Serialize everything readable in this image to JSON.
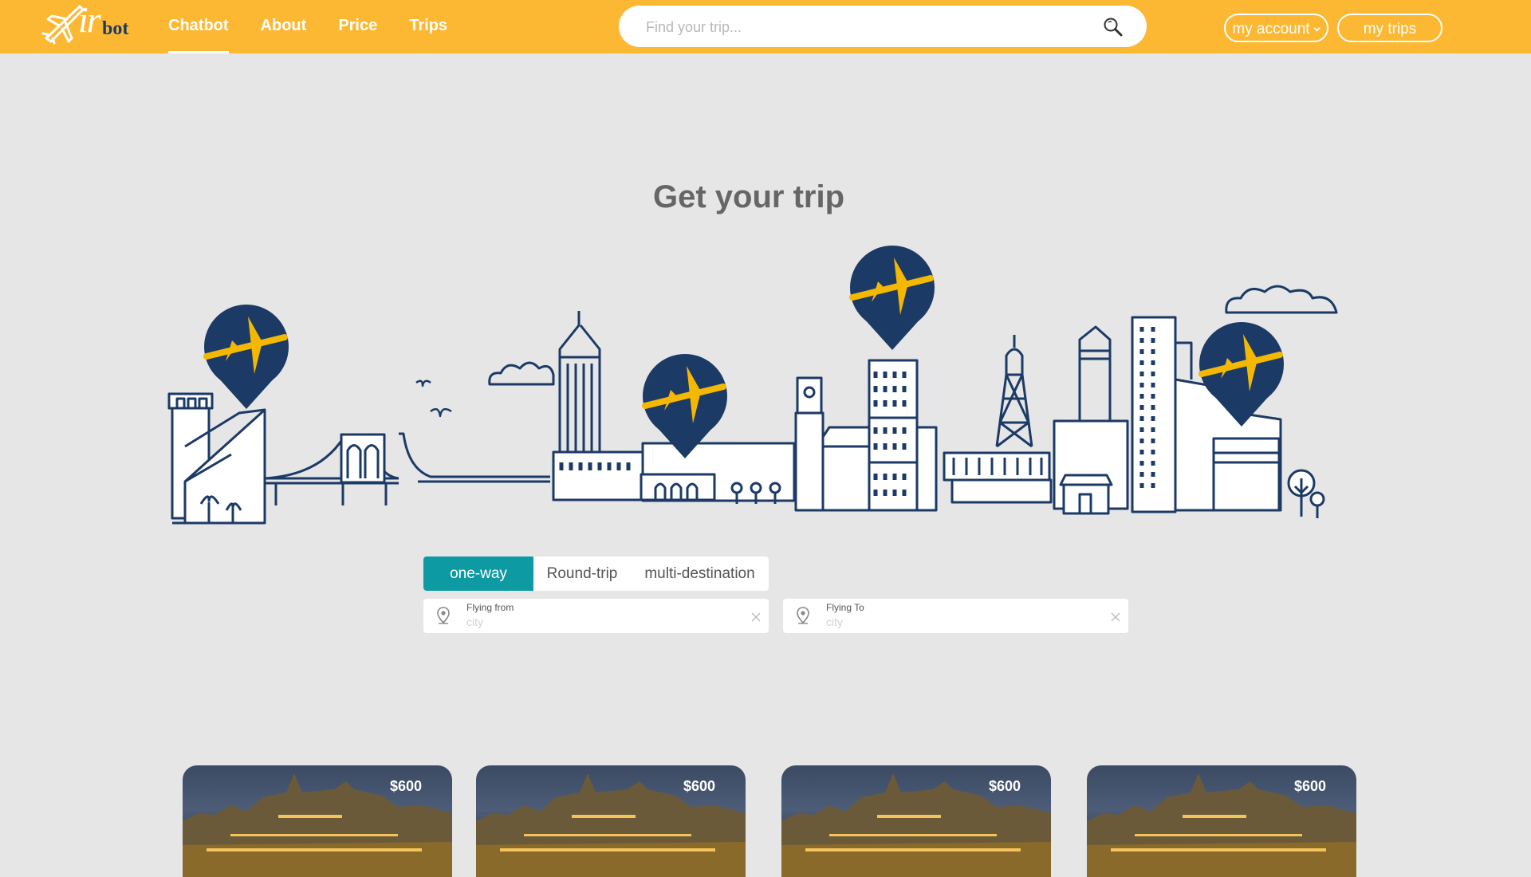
{
  "brand": {
    "logo_main": "ir",
    "logo_sub": "bot"
  },
  "nav": {
    "items": [
      {
        "label": "Chatbot",
        "active": true
      },
      {
        "label": "About",
        "active": false
      },
      {
        "label": "Price",
        "active": false
      },
      {
        "label": "Trips",
        "active": false
      }
    ]
  },
  "search": {
    "placeholder": "Find your trip..."
  },
  "account": {
    "my_account_label": "my account",
    "my_trips_label": "my trips"
  },
  "hero": {
    "title": "Get your trip"
  },
  "trip_type": {
    "tabs": [
      "one-way",
      "Round-trip",
      "multi-destination"
    ],
    "selected": "one-way"
  },
  "fields": {
    "from": {
      "label": "Flying from",
      "placeholder": "city",
      "value": ""
    },
    "to": {
      "label": "Flying To",
      "placeholder": "city",
      "value": ""
    }
  },
  "cards": [
    {
      "price": "$600"
    },
    {
      "price": "$600"
    },
    {
      "price": "$600"
    },
    {
      "price": "$600"
    }
  ],
  "colors": {
    "header": "#fdb833",
    "accent_teal": "#0d9aa2",
    "skyline_navy": "#1c3a66",
    "pin_yellow": "#f5b800",
    "background": "#e6e6e6"
  },
  "icons": [
    "plane-logo-icon",
    "search-icon",
    "chevron-down-icon",
    "location-pin-icon",
    "clear-icon",
    "map-pin-plane-icon"
  ]
}
